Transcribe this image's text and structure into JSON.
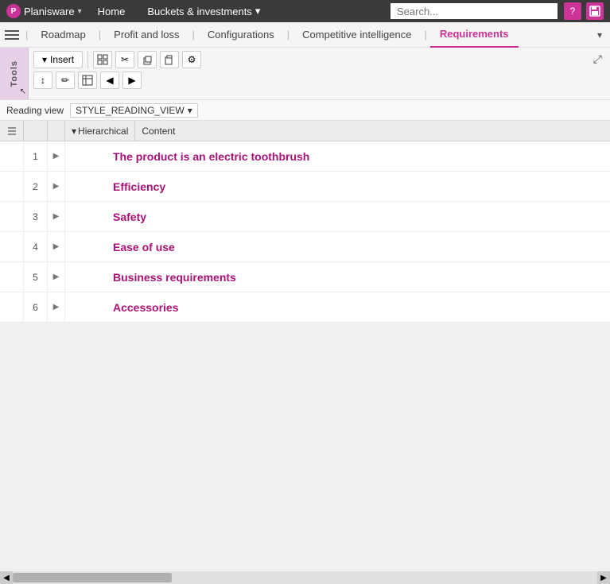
{
  "topbar": {
    "brand": "Planisware",
    "home": "Home",
    "module": "Buckets & investments",
    "module_dropdown": "▾",
    "search_placeholder": "Search...",
    "icon_help": "?",
    "icon_save": "💾"
  },
  "tabs": {
    "items": [
      {
        "id": "roadmap",
        "label": "Roadmap",
        "active": false
      },
      {
        "id": "profit",
        "label": "Profit and loss",
        "active": false
      },
      {
        "id": "configurations",
        "label": "Configurations",
        "active": false
      },
      {
        "id": "competitive",
        "label": "Competitive intelligence",
        "active": false
      },
      {
        "id": "requirements",
        "label": "Requirements",
        "active": true
      }
    ]
  },
  "toolbar": {
    "insert_label": "Insert",
    "tools_label": "Tools"
  },
  "reading_view": {
    "label": "Reading view",
    "value": "STYLE_READING_VIEW"
  },
  "table": {
    "col_hierarchical": "Hierarchical",
    "col_content": "Content",
    "rows": [
      {
        "num": "1",
        "content": "The product is an electric toothbrush"
      },
      {
        "num": "2",
        "content": "Efficiency"
      },
      {
        "num": "3",
        "content": "Safety"
      },
      {
        "num": "4",
        "content": "Ease of use"
      },
      {
        "num": "5",
        "content": "Business requirements"
      },
      {
        "num": "6",
        "content": "Accessories"
      }
    ]
  }
}
